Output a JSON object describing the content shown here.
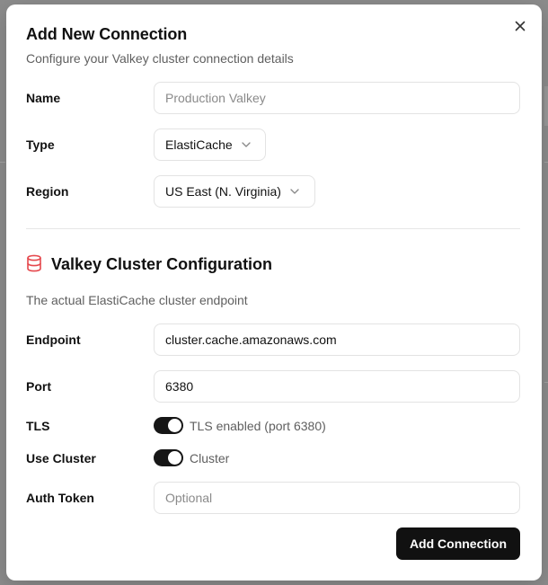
{
  "dialog": {
    "title": "Add New Connection",
    "subtitle": "Configure your Valkey cluster connection details",
    "close_icon": "close-icon"
  },
  "fields": {
    "name": {
      "label": "Name",
      "placeholder": "Production Valkey",
      "value": ""
    },
    "type": {
      "label": "Type",
      "selected": "ElastiCache"
    },
    "region": {
      "label": "Region",
      "selected": "US East (N. Virginia)"
    }
  },
  "section": {
    "icon": "database-icon",
    "icon_color": "#e5484d",
    "title": "Valkey Cluster Configuration",
    "description": "The actual ElastiCache cluster endpoint"
  },
  "cluster": {
    "endpoint": {
      "label": "Endpoint",
      "value": "cluster.cache.amazonaws.com"
    },
    "port": {
      "label": "Port",
      "value": "6380"
    },
    "tls": {
      "label": "TLS",
      "enabled": true,
      "status": "TLS enabled (port 6380)"
    },
    "use_cluster": {
      "label": "Use Cluster",
      "enabled": true,
      "status": "Cluster"
    },
    "auth_token": {
      "label": "Auth Token",
      "placeholder": "Optional",
      "value": ""
    }
  },
  "actions": {
    "submit_label": "Add Connection"
  }
}
